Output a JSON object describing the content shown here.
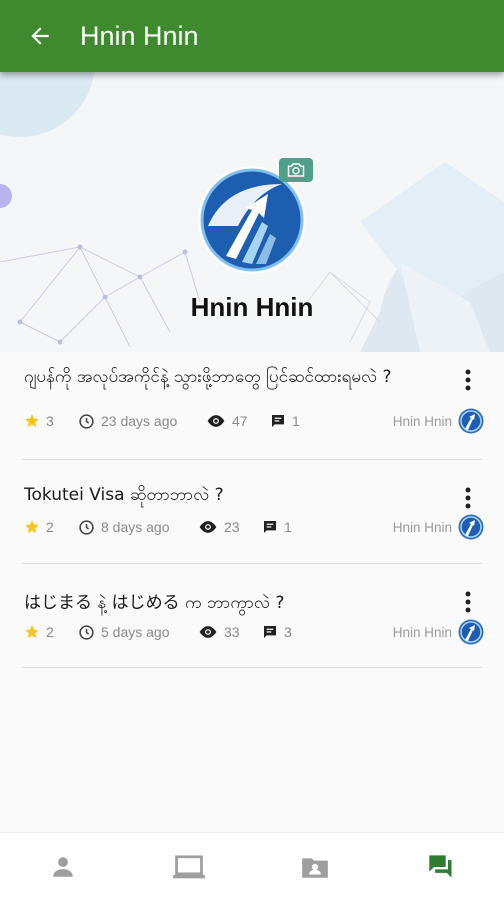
{
  "app_bar": {
    "title": "Hnin Hnin"
  },
  "profile": {
    "name": "Hnin Hnin"
  },
  "posts": [
    {
      "title": "ဂျပန်ကို အလုပ်အကိုင်နဲ့ သွားဖို့ဘာတွေ ပြင်ဆင်ထားရမလဲ ?",
      "stars": "3",
      "time": "23 days ago",
      "views": "47",
      "comments": "1",
      "author": "Hnin Hnin"
    },
    {
      "title": "Tokutei Visa ဆိုတာဘာလဲ ?",
      "stars": "2",
      "time": "8 days ago",
      "views": "23",
      "comments": "1",
      "author": "Hnin Hnin"
    },
    {
      "title": "はじまる နဲ့ はじめる က ဘာကွာလဲ ?",
      "stars": "2",
      "time": "5 days ago",
      "views": "33",
      "comments": "3",
      "author": "Hnin Hnin"
    }
  ],
  "colors": {
    "primary": "#3f8a2f",
    "star": "#f5c518",
    "active_nav": "#2e7d32",
    "inactive_nav": "#9e9e9e"
  },
  "bottom_nav": {
    "items": [
      {
        "icon": "person-icon",
        "active": false
      },
      {
        "icon": "laptop-icon",
        "active": false
      },
      {
        "icon": "contact-card-icon",
        "active": false
      },
      {
        "icon": "forum-icon",
        "active": true
      }
    ]
  }
}
